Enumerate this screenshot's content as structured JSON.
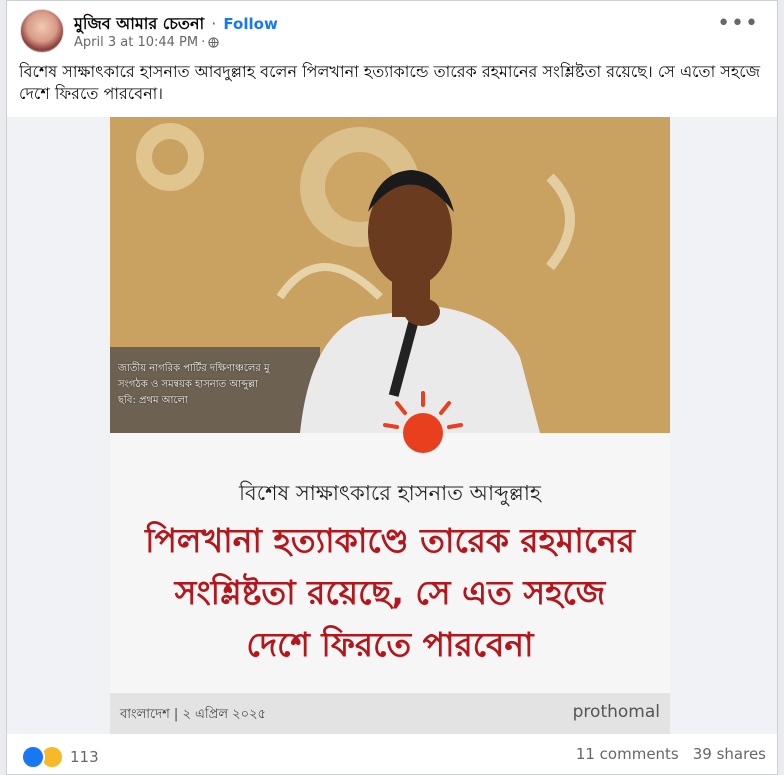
{
  "post": {
    "author": "মুজিব আমার চেতনা",
    "follow_label": "Follow",
    "timestamp": "April 3 at 10:44 PM",
    "text": "বিশেষ সাক্ষাৎকারে হাসনাত আবদুল্লাহ বলেন পিলখানা হত্যাকান্ডে তারেক রহমানের সংশ্লিষ্টতা রয়েছে। সে এতো সহজে দেশে ফিরতে পারবেনা।"
  },
  "image": {
    "photo_caption": [
      "জাতীয় নাগরিক পার্টির দক্ষিণাঞ্চলের মু",
      "সংগঠক ও সমন্বয়ক হাসনাত আব্দুল্লা",
      "ছবি: প্রথম আলো"
    ],
    "subheading": "বিশেষ সাক্ষাৎকারে হাসনাত আব্দুল্লাহ",
    "headline": [
      "পিলখানা হত্যাকাণ্ডে তারেক রহমানের",
      "সংশ্লিষ্টতা রয়েছে, সে এত সহজে",
      "দেশে ফিরতে পারবেনা"
    ],
    "footer_left": "বাংলাদেশ | ২ এপ্রিল ২০২৫",
    "footer_right": "prothomal"
  },
  "engagement": {
    "reaction_count": "113",
    "comments": "11 comments",
    "shares": "39 shares"
  },
  "icons": [
    "more-options-icon",
    "globe-icon",
    "like-reaction-icon",
    "haha-reaction-icon"
  ],
  "colors": {
    "follow": "#1877f2",
    "headline": "#b4161b",
    "sun": "#e8401f"
  }
}
